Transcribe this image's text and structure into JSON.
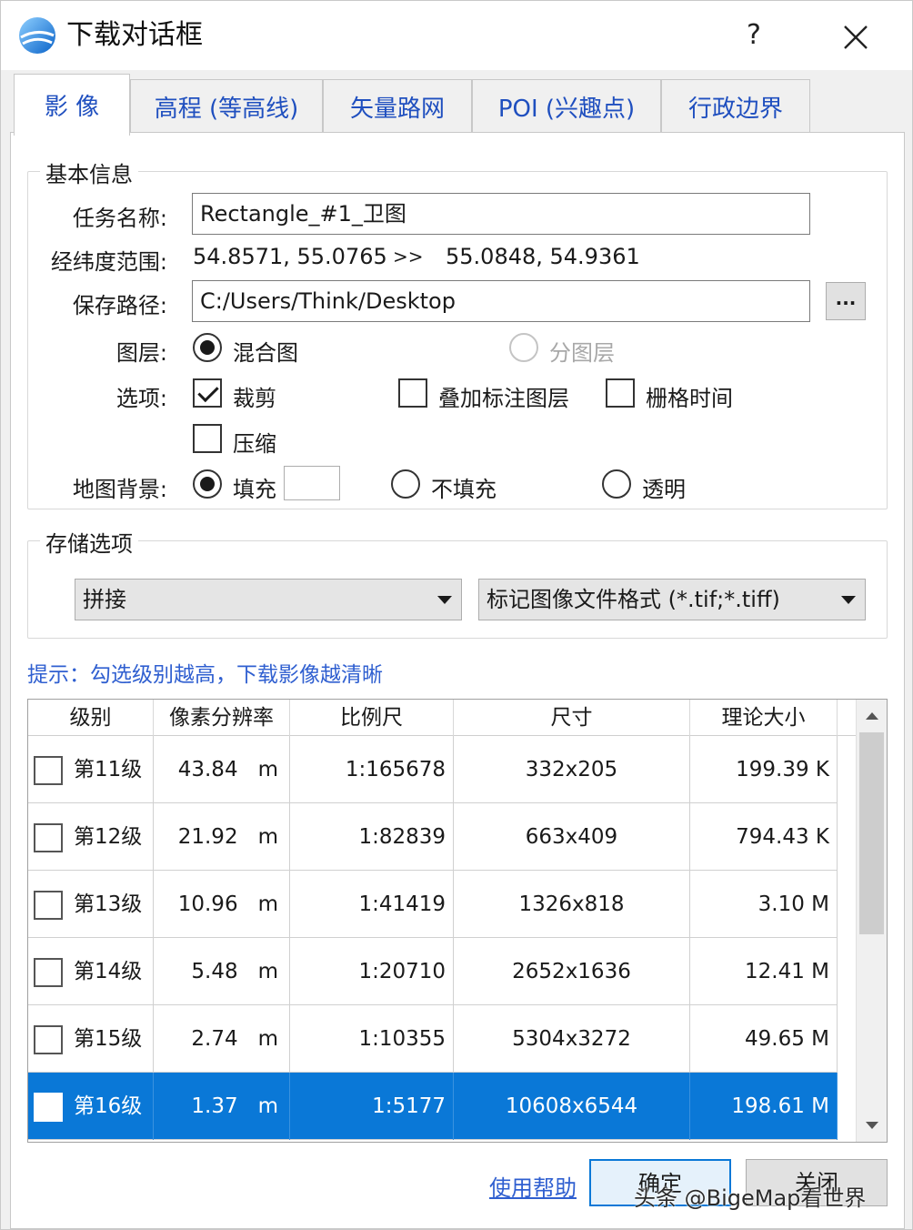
{
  "window": {
    "title": "下载对话框",
    "help": "?",
    "icon": "globe-app-icon"
  },
  "tabs": [
    {
      "label": "影  像",
      "active": true
    },
    {
      "label": "高程 (等高线)",
      "active": false
    },
    {
      "label": "矢量路网",
      "active": false
    },
    {
      "label": "POI (兴趣点)",
      "active": false
    },
    {
      "label": "行政边界",
      "active": false
    }
  ],
  "basic": {
    "group_title": "基本信息",
    "task_label": "任务名称:",
    "task_value": "Rectangle_#1_卫图",
    "range_label": "经纬度范围:",
    "range_from": "54.8571, 55.0765",
    "range_arrow": ">>",
    "range_to": "55.0848, 54.9361",
    "path_label": "保存路径:",
    "path_value": "C:/Users/Think/Desktop",
    "browse_label": "...",
    "layer_label": "图层:",
    "layer_mixed": "混合图",
    "layer_split": "分图层",
    "options_label": "选项:",
    "opt_crop": "裁剪",
    "opt_overlay": "叠加标注图层",
    "opt_grid_time": "栅格时间",
    "opt_compress": "压缩",
    "bg_label": "地图背景:",
    "bg_fill": "填充",
    "bg_nofill": "不填充",
    "bg_transparent": "透明",
    "fill_color": "#ffffff"
  },
  "storage": {
    "group_title": "存储选项",
    "mode": "拼接",
    "format": "标记图像文件格式 (*.tif;*.tiff)"
  },
  "hint": "提示：勾选级别越高，下载影像越清晰",
  "table": {
    "headers": [
      "级别",
      "像素分辨率",
      "比例尺",
      "尺寸",
      "理论大小"
    ],
    "rows": [
      {
        "level": "第11级",
        "res": "43.84",
        "unit": "m",
        "scale": "1:165678",
        "size": "332x205",
        "bytes": "199.39 K",
        "checked": false,
        "selected": false
      },
      {
        "level": "第12级",
        "res": "21.92",
        "unit": "m",
        "scale": "1:82839",
        "size": "663x409",
        "bytes": "794.43 K",
        "checked": false,
        "selected": false
      },
      {
        "level": "第13级",
        "res": "10.96",
        "unit": "m",
        "scale": "1:41419",
        "size": "1326x818",
        "bytes": "3.10 M",
        "checked": false,
        "selected": false
      },
      {
        "level": "第14级",
        "res": "5.48",
        "unit": "m",
        "scale": "1:20710",
        "size": "2652x1636",
        "bytes": "12.41 M",
        "checked": false,
        "selected": false
      },
      {
        "level": "第15级",
        "res": "2.74",
        "unit": "m",
        "scale": "1:10355",
        "size": "5304x3272",
        "bytes": "49.65 M",
        "checked": false,
        "selected": false
      },
      {
        "level": "第16级",
        "res": "1.37",
        "unit": "m",
        "scale": "1:5177",
        "size": "10608x6544",
        "bytes": "198.61 M",
        "checked": false,
        "selected": true
      }
    ]
  },
  "footer": {
    "help_link": "使用帮助",
    "ok": "确定",
    "close": "关闭"
  },
  "watermark": "头条 @BigeMap看世界",
  "colors": {
    "accent": "#0a78d7",
    "tab_text": "#1f4fbf",
    "hint_text": "#2f5fd0"
  }
}
